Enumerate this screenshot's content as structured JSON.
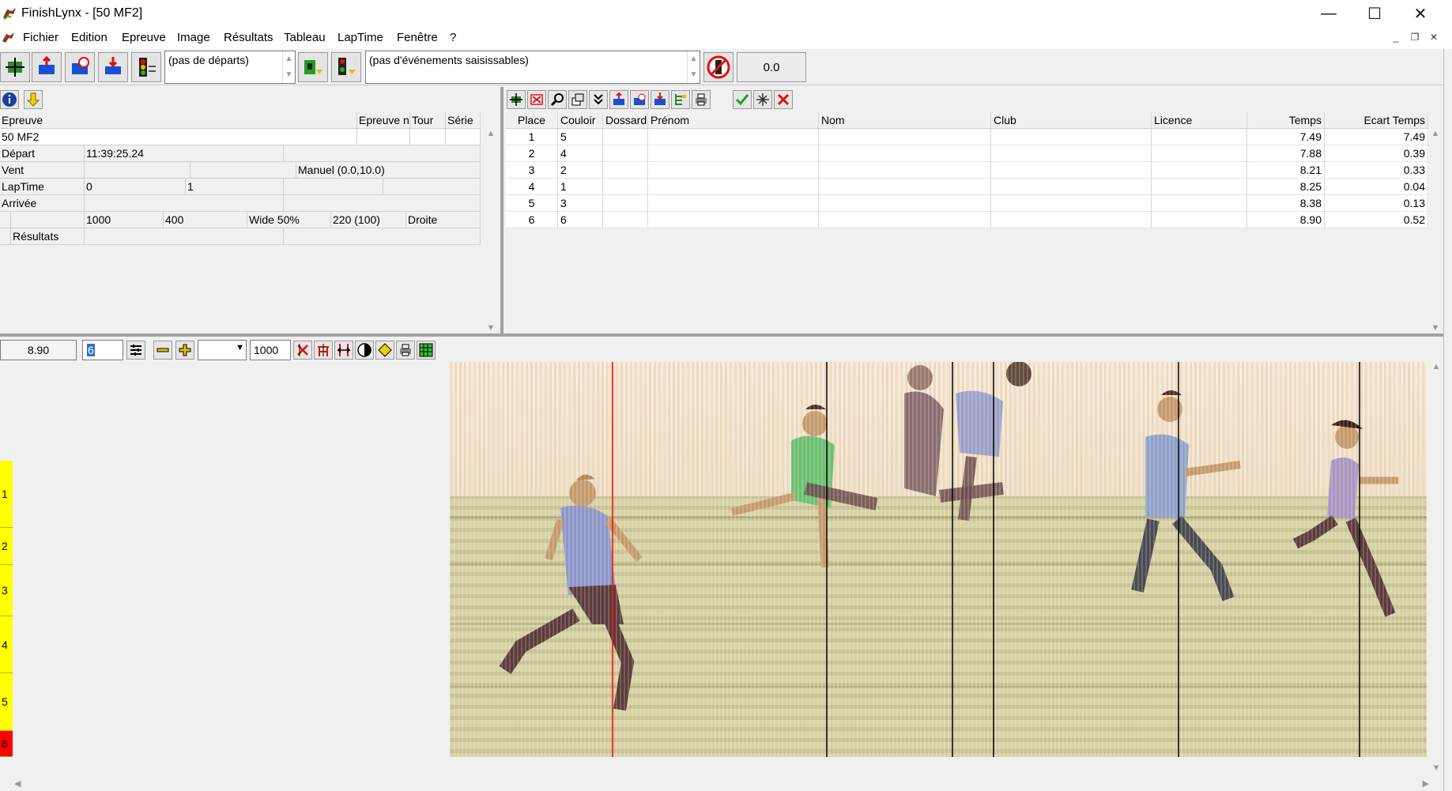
{
  "window": {
    "title": "FinishLynx - [50 MF2]",
    "controls": [
      "—",
      "☐",
      "✕"
    ]
  },
  "menu": [
    "Fichier",
    "Edition",
    "Epreuve",
    "Image",
    "Résultats",
    "Tableau",
    "LapTime",
    "Fenêtre",
    "?"
  ],
  "toolbar": {
    "starts_combo": "(pas de départs)",
    "events_combo": "(pas d'événements saisissables)",
    "wind_value": "0.0"
  },
  "event_panel": {
    "headers": {
      "epreuve": "Epreuve",
      "epreuve_n": "Epreuve n",
      "tour": "Tour",
      "serie": "Série"
    },
    "event_name": "50 MF2",
    "rows": {
      "depart": {
        "label": "Départ",
        "value": "11:39:25.24"
      },
      "vent": {
        "label": "Vent",
        "value": "Manuel (0.0,10.0)"
      },
      "laptime": {
        "label": "LapTime",
        "v1": "0",
        "v2": "1"
      },
      "arrivee": {
        "label": "Arrivée"
      },
      "params": {
        "c1": "1000",
        "c2": "400",
        "c3": "Wide 50%",
        "c4": "220  (100)",
        "c5": "Droite"
      },
      "resultats": {
        "label": "Résultats"
      }
    }
  },
  "results": {
    "headers": [
      "Place",
      "Couloir",
      "Dossard",
      "Prénom",
      "Nom",
      "Club",
      "Licence",
      "Temps",
      "Ecart Temps"
    ],
    "rows": [
      {
        "place": "1",
        "couloir": "5",
        "temps": "7.49",
        "ecart": "7.49"
      },
      {
        "place": "2",
        "couloir": "4",
        "temps": "7.88",
        "ecart": "0.39"
      },
      {
        "place": "3",
        "couloir": "2",
        "temps": "8.21",
        "ecart": "0.33"
      },
      {
        "place": "4",
        "couloir": "1",
        "temps": "8.25",
        "ecart": "0.04"
      },
      {
        "place": "5",
        "couloir": "3",
        "temps": "8.38",
        "ecart": "0.13"
      },
      {
        "place": "6",
        "couloir": "6",
        "temps": "8.90",
        "ecart": "0.52"
      }
    ]
  },
  "image_toolbar": {
    "time_value": "8.90",
    "lane_field": "6",
    "zoom_value": "1000"
  },
  "lanes": [
    "1",
    "2",
    "3",
    "4",
    "5",
    "6"
  ],
  "colors": {
    "lane_tab": "#ffff00",
    "lane_active": "#ff0000",
    "time_line": "#ff0000"
  }
}
